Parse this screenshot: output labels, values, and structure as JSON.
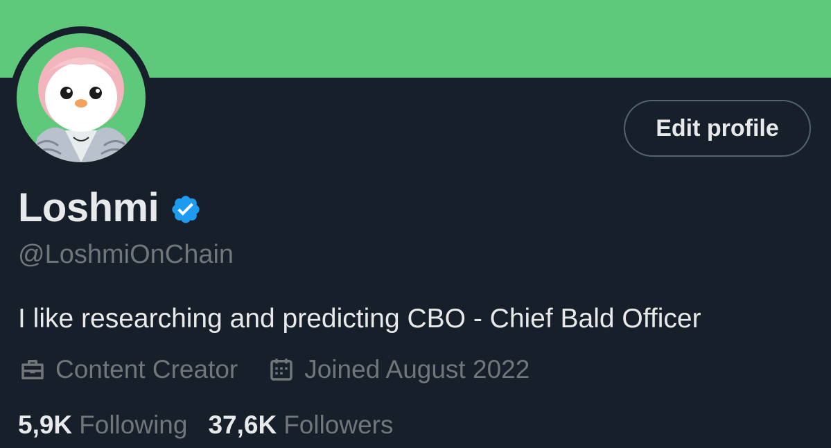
{
  "colors": {
    "banner": "#5ec97a",
    "background": "#171f2a",
    "primary_text": "#e7e9ea",
    "secondary_text": "#71767b",
    "verified_badge": "#1d9bf0",
    "button_border": "#536471"
  },
  "profile": {
    "name": "Loshmi",
    "handle": "@LoshmiOnChain",
    "bio": "I like researching and predicting CBO - Chief Bald Officer",
    "verified": true,
    "verified_icon": "verified-badge-icon",
    "avatar_icon": "penguin-avatar"
  },
  "actions": {
    "edit_profile_label": "Edit profile"
  },
  "meta": {
    "category": "Content Creator",
    "category_icon": "briefcase-icon",
    "joined": "Joined August 2022",
    "joined_icon": "calendar-icon"
  },
  "stats": {
    "following_count": "5,9K",
    "following_label": "Following",
    "followers_count": "37,6K",
    "followers_label": "Followers"
  }
}
